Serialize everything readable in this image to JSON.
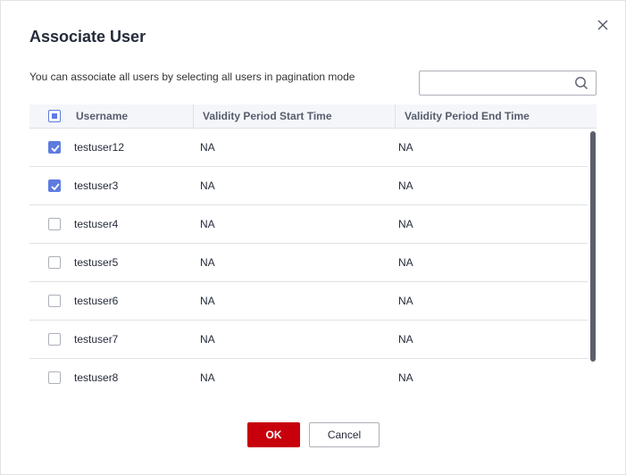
{
  "dialog": {
    "title": "Associate User",
    "description": "You can associate all users by selecting all users in pagination mode"
  },
  "search": {
    "value": "",
    "placeholder": ""
  },
  "table": {
    "columns": [
      "Username",
      "Validity Period Start Time",
      "Validity Period End Time"
    ],
    "select_all_state": "partial",
    "rows": [
      {
        "username": "testuser12",
        "start": "NA",
        "end": "NA",
        "checked": true
      },
      {
        "username": "testuser3",
        "start": "NA",
        "end": "NA",
        "checked": true
      },
      {
        "username": "testuser4",
        "start": "NA",
        "end": "NA",
        "checked": false
      },
      {
        "username": "testuser5",
        "start": "NA",
        "end": "NA",
        "checked": false
      },
      {
        "username": "testuser6",
        "start": "NA",
        "end": "NA",
        "checked": false
      },
      {
        "username": "testuser7",
        "start": "NA",
        "end": "NA",
        "checked": false
      },
      {
        "username": "testuser8",
        "start": "NA",
        "end": "NA",
        "checked": false
      }
    ]
  },
  "buttons": {
    "ok": "OK",
    "cancel": "Cancel"
  },
  "icons": {
    "close": "close-icon",
    "search": "search-icon"
  },
  "colors": {
    "primary": "#c7000b",
    "checkbox": "#5e7ce0"
  }
}
